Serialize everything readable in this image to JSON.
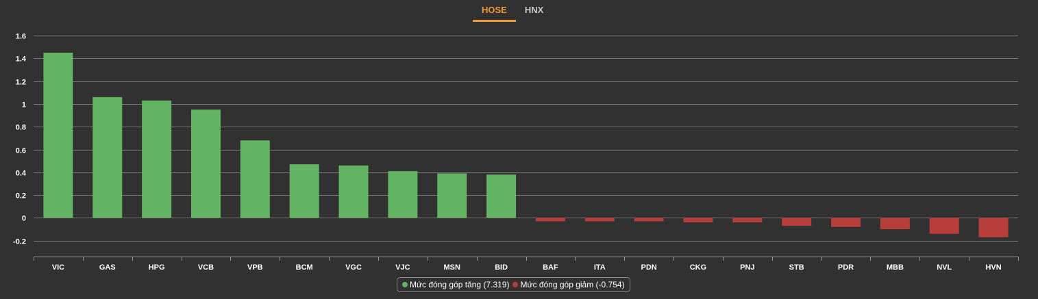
{
  "tabs": [
    {
      "label": "HOSE",
      "active": true
    },
    {
      "label": "HNX",
      "active": false
    }
  ],
  "colors": {
    "positive": "#63b462",
    "negative": "#b73e3b",
    "active_tab": "#f19a39",
    "background": "#313131",
    "gridline": "#7a7a7a",
    "text": "#ffffff"
  },
  "legend": [
    {
      "label": "Mức đóng góp tăng (7.319)",
      "color": "#63b462"
    },
    {
      "label": "Mức đóng góp giảm (-0.754)",
      "color": "#b73e3b"
    }
  ],
  "chart_data": {
    "type": "bar",
    "title": "",
    "xlabel": "",
    "ylabel": "",
    "ylim": [
      -0.3,
      1.6
    ],
    "yticks": [
      1.6,
      1.4,
      1.2,
      1,
      0.8,
      0.6,
      0.4,
      0.2,
      0,
      -0.2
    ],
    "grid": true,
    "legend_position": "bottom-center",
    "categories": [
      "VIC",
      "GAS",
      "HPG",
      "VCB",
      "VPB",
      "BCM",
      "VGC",
      "VJC",
      "MSN",
      "BID",
      "BAF",
      "ITA",
      "PDN",
      "CKG",
      "PNJ",
      "STB",
      "PDR",
      "MBB",
      "NVL",
      "HVN"
    ],
    "values": [
      1.45,
      1.06,
      1.03,
      0.95,
      0.68,
      0.47,
      0.46,
      0.41,
      0.39,
      0.38,
      -0.03,
      -0.03,
      -0.03,
      -0.04,
      -0.04,
      -0.07,
      -0.08,
      -0.1,
      -0.14,
      -0.17
    ]
  }
}
